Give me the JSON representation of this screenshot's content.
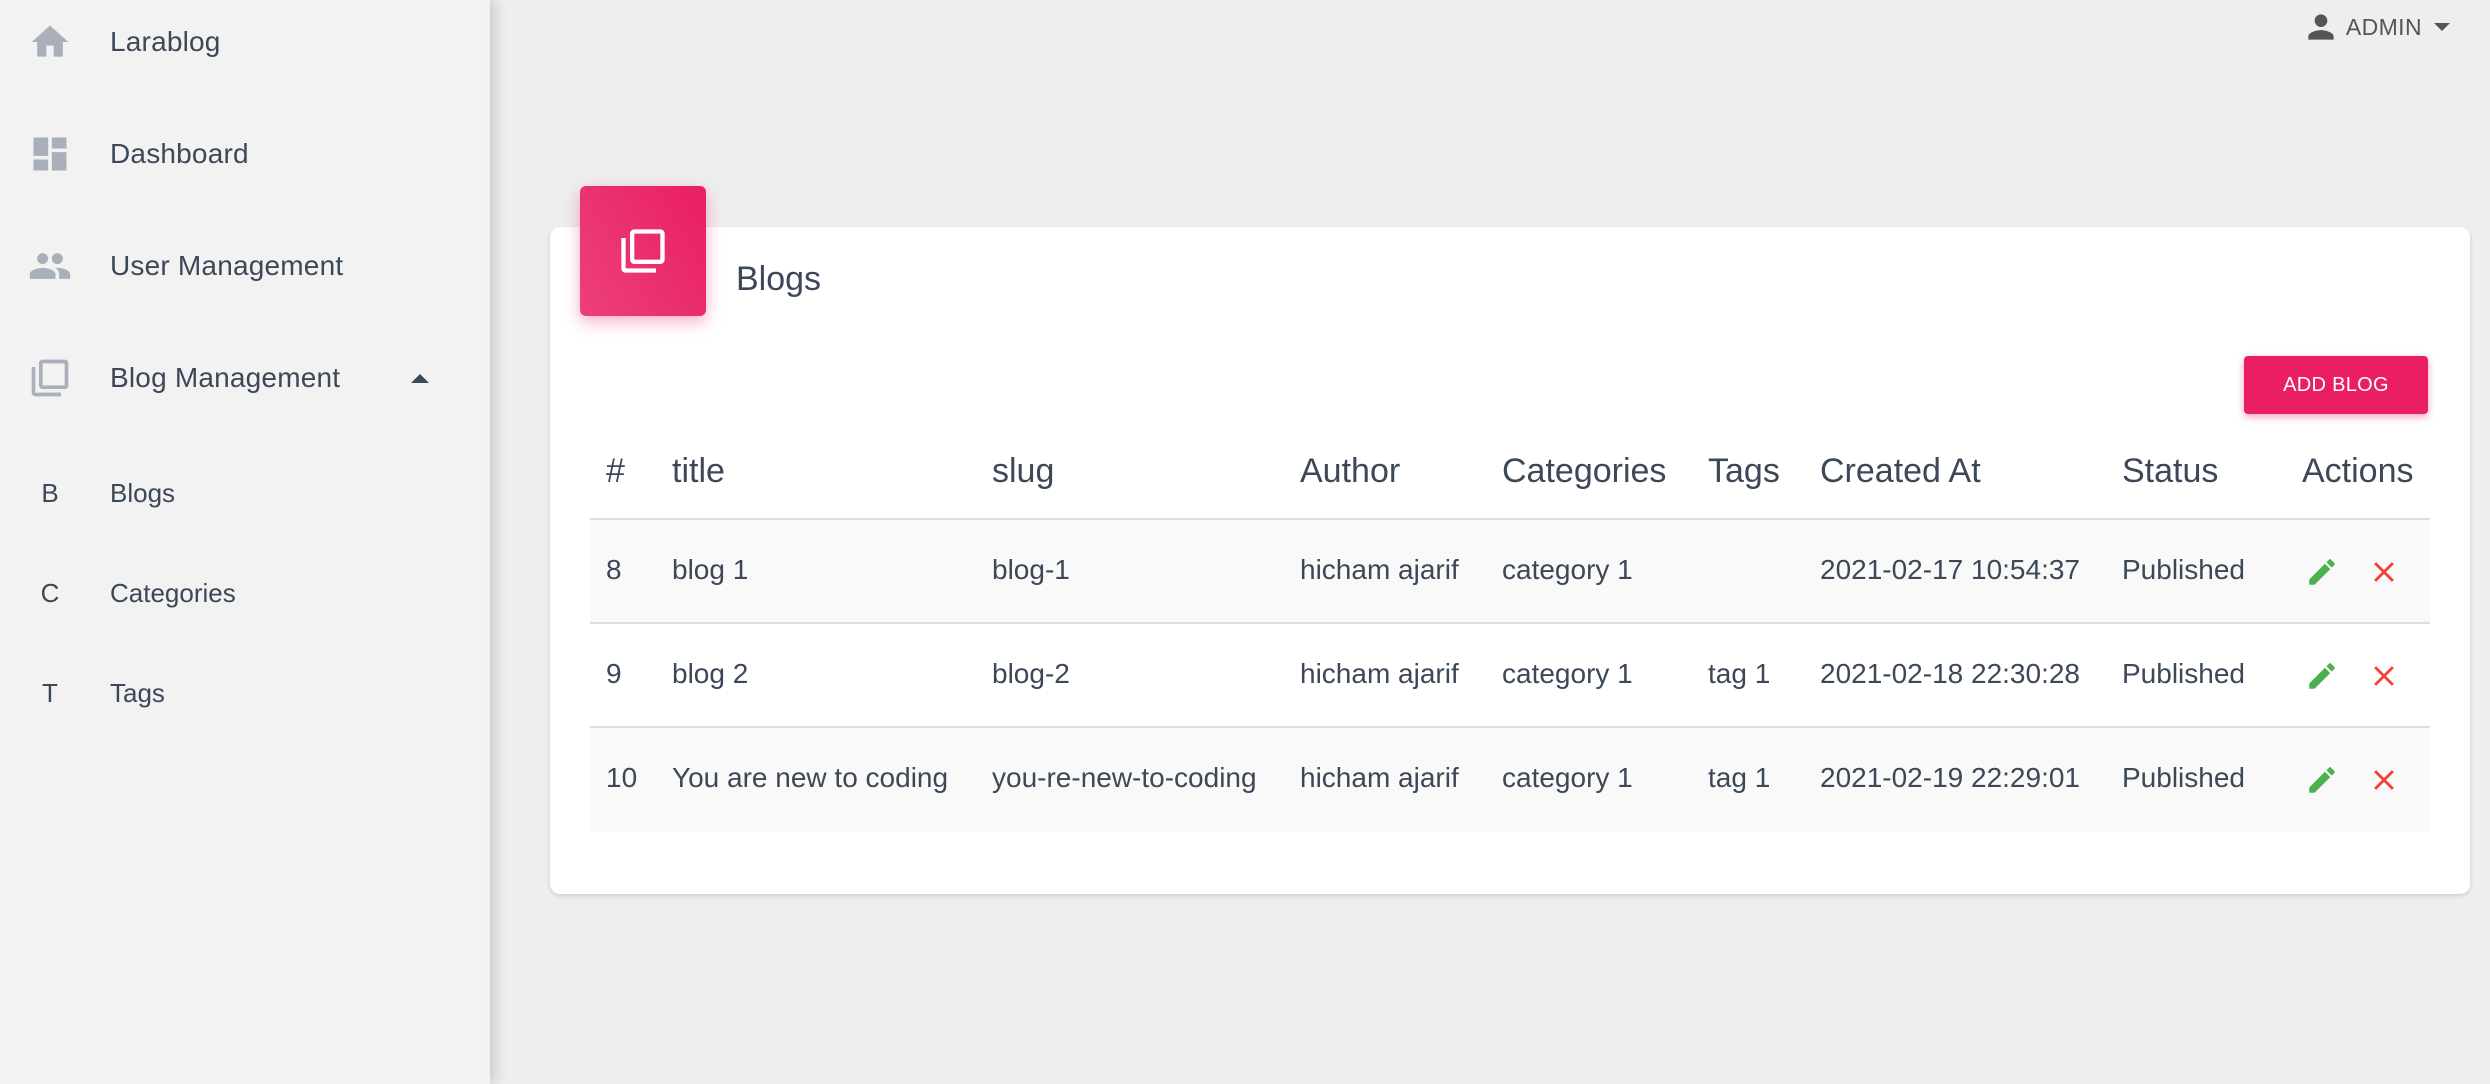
{
  "sidebar": {
    "items": [
      {
        "label": "Larablog",
        "icon": "home-icon"
      },
      {
        "label": "Dashboard",
        "icon": "dashboard-icon"
      },
      {
        "label": "User Management",
        "icon": "people-icon"
      },
      {
        "label": "Blog Management",
        "icon": "library-books-icon"
      }
    ],
    "subitems": [
      {
        "abbr": "B",
        "label": "Blogs"
      },
      {
        "abbr": "C",
        "label": "Categories"
      },
      {
        "abbr": "T",
        "label": "Tags"
      }
    ]
  },
  "topbar": {
    "user_label": "ADMIN",
    "user_icon": "person-icon"
  },
  "card": {
    "title": "Blogs",
    "icon": "library-books-icon",
    "add_button": "ADD BLOG",
    "accent_color": "#e91e63"
  },
  "table": {
    "headers": [
      "#",
      "title",
      "slug",
      "Author",
      "Categories",
      "Tags",
      "Created At",
      "Status",
      "Actions"
    ],
    "rows": [
      {
        "id": "8",
        "title": "blog 1",
        "slug": "blog-1",
        "author": "hicham ajarif",
        "categories": "category 1",
        "tags": "",
        "created_at": "2021-02-17 10:54:37",
        "status": "Published"
      },
      {
        "id": "9",
        "title": "blog 2",
        "slug": "blog-2",
        "author": "hicham ajarif",
        "categories": "category 1",
        "tags": "tag 1",
        "created_at": "2021-02-18 22:30:28",
        "status": "Published"
      },
      {
        "id": "10",
        "title": "You are new to coding",
        "slug": "you-re-new-to-coding",
        "author": "hicham ajarif",
        "categories": "category 1",
        "tags": "tag 1",
        "created_at": "2021-02-19 22:29:01",
        "status": "Published"
      }
    ],
    "edit_icon": "pencil-icon",
    "delete_icon": "close-icon",
    "edit_color": "#4caf50",
    "delete_color": "#f44336"
  }
}
